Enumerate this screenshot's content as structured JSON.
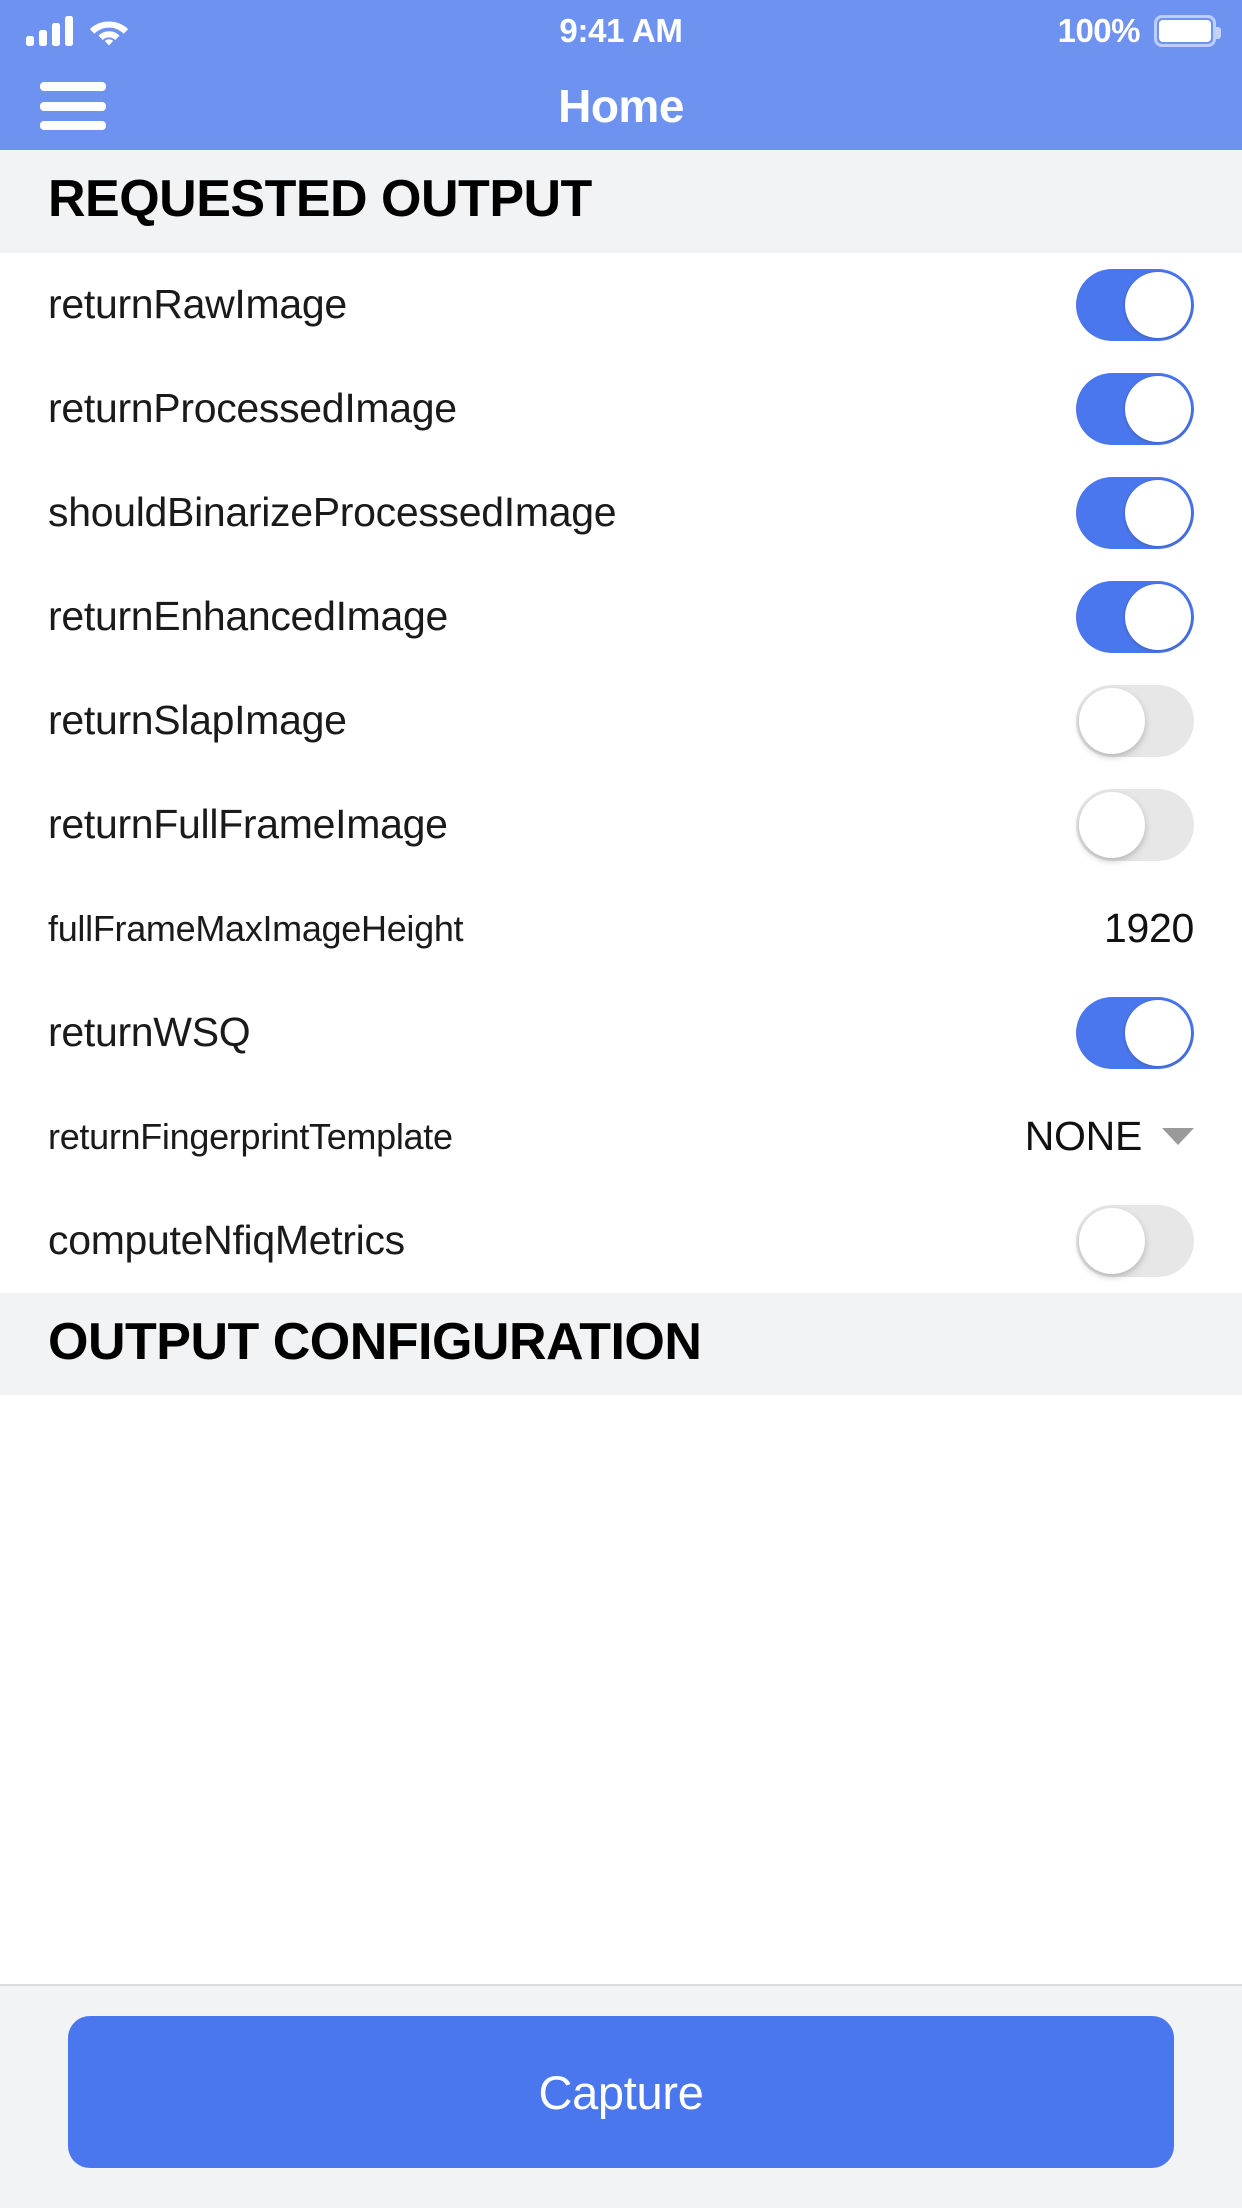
{
  "status_bar": {
    "signal_icon": "cellular-signal-icon",
    "wifi_icon": "wifi-icon",
    "time": "9:41 AM",
    "battery_percent": "100%",
    "battery_icon": "battery-full-icon"
  },
  "nav_bar": {
    "menu_icon": "hamburger-menu-icon",
    "title": "Home"
  },
  "sections": [
    {
      "title": "REQUESTED OUTPUT",
      "rows": [
        {
          "label": "returnRawImage",
          "type": "toggle",
          "state": "on"
        },
        {
          "label": "returnProcessedImage",
          "type": "toggle",
          "state": "on"
        },
        {
          "label": "shouldBinarizeProcessedImage",
          "type": "toggle",
          "state": "on"
        },
        {
          "label": "returnEnhancedImage",
          "type": "toggle",
          "state": "on"
        },
        {
          "label": "returnSlapImage",
          "type": "toggle",
          "state": "off"
        },
        {
          "label": "returnFullFrameImage",
          "type": "toggle",
          "state": "off"
        },
        {
          "label": "fullFrameMaxImageHeight",
          "type": "value",
          "value": "1920"
        },
        {
          "label": "returnWSQ",
          "type": "toggle",
          "state": "on"
        },
        {
          "label": "returnFingerprintTemplate",
          "type": "dropdown",
          "value": "NONE",
          "caret_icon": "chevron-down-icon"
        },
        {
          "label": "computeNfiqMetrics",
          "type": "toggle",
          "state": "off"
        }
      ]
    },
    {
      "title": "OUTPUT CONFIGURATION",
      "rows": []
    }
  ],
  "bottom_bar": {
    "capture_label": "Capture"
  },
  "colors": {
    "brand_blue": "#6e92f0",
    "accent_blue": "#4a76ee",
    "section_bg": "#f2f3f5",
    "toggle_off": "#e7e7e7"
  }
}
